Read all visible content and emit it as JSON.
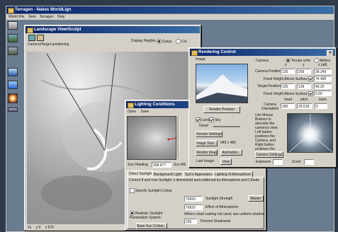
{
  "app": {
    "title": "Terragen - Nakes WorldLign",
    "menu": [
      "World File",
      "View",
      "Terragen",
      "Help"
    ]
  },
  "landscape": {
    "title": "Landscape View/Sculpt",
    "mode_label": "Camera/Target positioning",
    "display_heights_label": "Display Heights",
    "opt_grays": "Grays",
    "opt_colour": "Col",
    "status": [
      "1k",
      "y 0",
      "z 675"
    ]
  },
  "lighting": {
    "title": "Lighting Conditions",
    "menu": [
      "Open",
      "Save"
    ],
    "sun_heading_label": "Sun Heading",
    "sun_heading_value": "308.677",
    "sun_alt_label": "Sun Alti",
    "tabs": [
      "Direct Sunlight",
      "Background Light",
      "Sun's Appearance",
      "Lighting of Atmosphere"
    ],
    "desc": "Control 8 and how Sunlight 's diminished and reddened by Atmosphere and Clouds",
    "specify_colour": "Specify Sunlight Colour",
    "sun_strength_value": "70920",
    "sun_strength_label": "Sunlight Strength",
    "atten_value": "70920",
    "atten_label": "Effect of Atmosphere",
    "realistic": "Realistic Sunlight Penetration System",
    "where_text": "Where cloud casting not used, use uniform shadow",
    "shadow_value": "220",
    "shadow_label": "Percent Shadowed",
    "base_sun_btn": "Base Sun Colour...",
    "master_btn": "Master"
  },
  "rendering": {
    "title": "Rendering Control",
    "image_label": "Image",
    "render_preview": "Render Preview",
    "land_label": "Land",
    "sky_label": "Sky",
    "detail_label": "Detail",
    "render_settings": "Render Settings...",
    "image_size_btn": "Image Size...",
    "image_size_value": "640 x 480",
    "render_image": "Render Image",
    "animation": "Animation...",
    "last_image": "Last Image:",
    "view_btn": "View",
    "camera_label": "Camera",
    "terrain_units": "Terrain units",
    "metres": "Metres",
    "x_label": "x",
    "y_label": "y",
    "z_label": "z (alt)",
    "camera_pos_label": "Camera Position",
    "camera_pos": [
      "126",
      "259",
      "28.249"
    ],
    "fixed_height_label": "Fixed Height Above Surface",
    "fixed_height_value": "74.489",
    "target_pos_label": "Target Position",
    "target_pos": [
      "126",
      "128",
      "40.25"
    ],
    "fixed_height2_value": "0.00",
    "cam_orient_label": "Camera Orientation",
    "head_label": "head",
    "pitch_label": "pitch",
    "bank_label": "bank",
    "orient": [
      "180",
      "25.618",
      "0"
    ],
    "mouse_hint": "Use Mouse Buttons to describe the camera's view.",
    "left_hint": "Left button positions the Camera, and Right button positions the Target",
    "camera_settings": "Camera Settings...",
    "exposure_label": "Exposure",
    "zoom_label": "Zoom"
  },
  "colors": {
    "desktop": "#2f3a4a",
    "titlebar": "#0a246a",
    "panel": "#d4d0c8"
  }
}
